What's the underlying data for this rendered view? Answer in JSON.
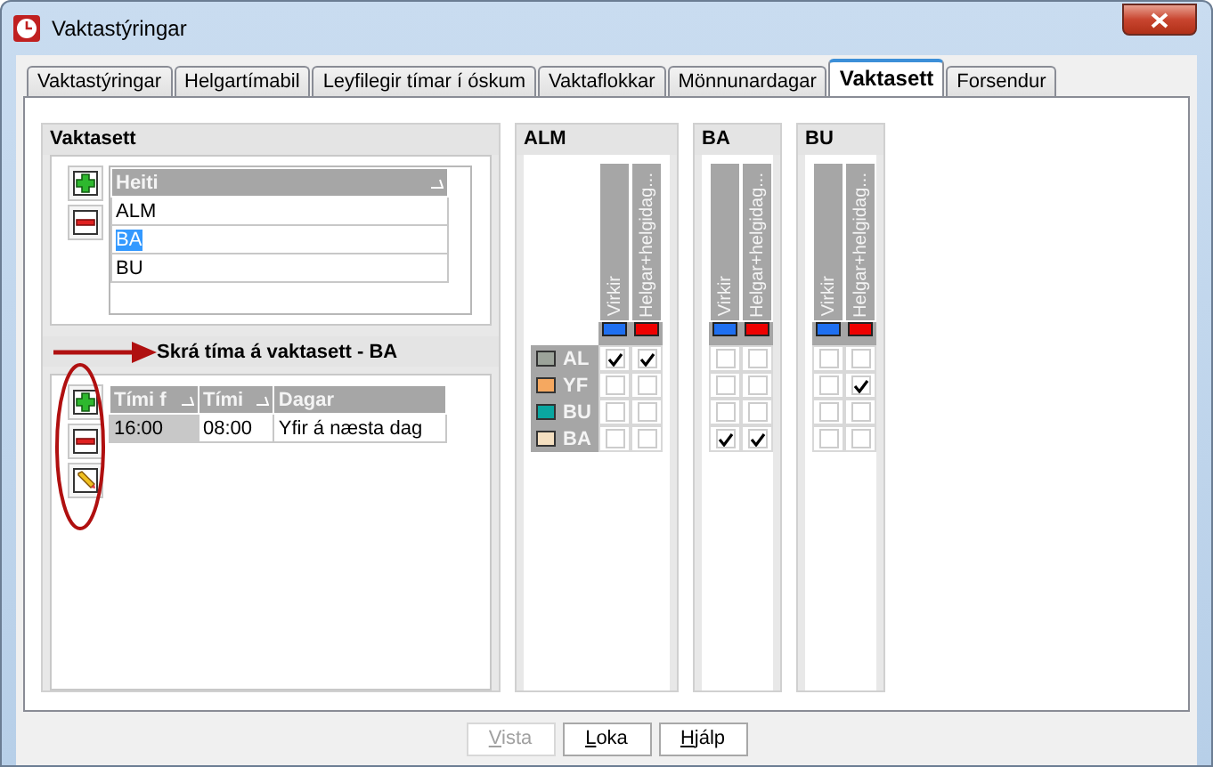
{
  "window": {
    "title": "Vaktastýringar"
  },
  "tabs": [
    {
      "label": "Vaktastýringar",
      "selected": false
    },
    {
      "label": "Helgartímabil",
      "selected": false
    },
    {
      "label": "Leyfilegir tímar í óskum",
      "selected": false
    },
    {
      "label": "Vaktaflokkar",
      "selected": false
    },
    {
      "label": "Mönnunardagar",
      "selected": false
    },
    {
      "label": "Vaktasett",
      "selected": true
    },
    {
      "label": "Forsendur",
      "selected": false
    }
  ],
  "vaktasett": {
    "title": "Vaktasett",
    "column": "Heiti",
    "rows": [
      {
        "name": "ALM",
        "selected": false
      },
      {
        "name": "BA",
        "selected": true
      },
      {
        "name": "BU",
        "selected": false
      }
    ]
  },
  "times": {
    "title": "Skrá tíma á vaktasett - BA",
    "columns": [
      "Tími f",
      "Tími",
      "Dagar"
    ],
    "rows": [
      [
        "16:00",
        "08:00",
        "Yfir á næsta dag"
      ]
    ]
  },
  "groups": [
    {
      "title": "ALM",
      "columns": [
        {
          "label": "Virkir",
          "color": "#1e6ff0"
        },
        {
          "label": "Helgar+helgidag...",
          "color": "#ee0000"
        }
      ],
      "rows": [
        {
          "label": "AL",
          "color": "#9ca39a",
          "checks": [
            true,
            true
          ]
        },
        {
          "label": "YF",
          "color": "#f5a860",
          "checks": [
            false,
            false
          ]
        },
        {
          "label": "BU",
          "color": "#0aa6a0",
          "checks": [
            false,
            false
          ]
        },
        {
          "label": "BA",
          "color": "#f4dfc0",
          "checks": [
            false,
            false
          ]
        }
      ]
    },
    {
      "title": "BA",
      "columns": [
        {
          "label": "Virkir",
          "color": "#1e6ff0"
        },
        {
          "label": "Helgar+helgidag...",
          "color": "#ee0000"
        }
      ],
      "rows": [
        {
          "checks": [
            false,
            false
          ]
        },
        {
          "checks": [
            false,
            false
          ]
        },
        {
          "checks": [
            false,
            false
          ]
        },
        {
          "checks": [
            true,
            true
          ]
        }
      ]
    },
    {
      "title": "BU",
      "columns": [
        {
          "label": "Virkir",
          "color": "#1e6ff0"
        },
        {
          "label": "Helgar+helgidag...",
          "color": "#ee0000"
        }
      ],
      "rows": [
        {
          "checks": [
            false,
            false
          ]
        },
        {
          "checks": [
            false,
            true
          ]
        },
        {
          "checks": [
            false,
            false
          ]
        },
        {
          "checks": [
            false,
            false
          ]
        }
      ]
    }
  ],
  "buttons": [
    {
      "label": "Vista",
      "disabled": true
    },
    {
      "label": "Loka",
      "disabled": false
    },
    {
      "label": "Hjálp",
      "disabled": false
    }
  ]
}
